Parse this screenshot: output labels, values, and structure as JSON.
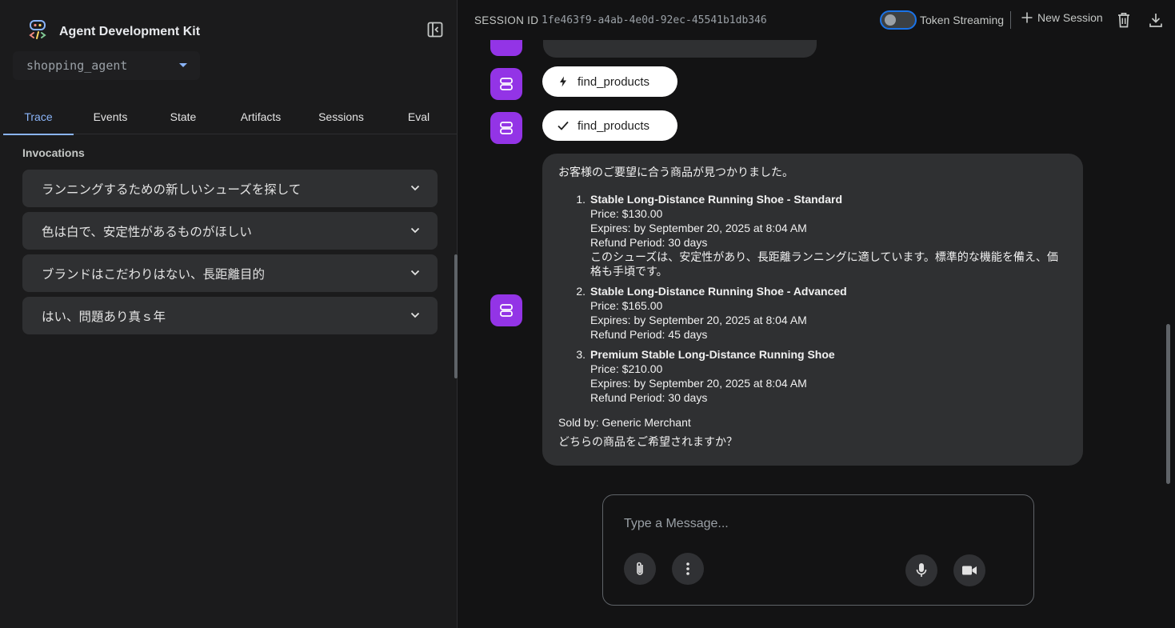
{
  "app": {
    "title": "Agent Development Kit",
    "agent_name": "shopping_agent"
  },
  "tabs": [
    {
      "label": "Trace",
      "active": true
    },
    {
      "label": "Events"
    },
    {
      "label": "State"
    },
    {
      "label": "Artifacts"
    },
    {
      "label": "Sessions"
    },
    {
      "label": "Eval"
    }
  ],
  "invocations": {
    "heading": "Invocations",
    "items": [
      "ランニングするための新しいシューズを探して",
      "色は白で、安定性があるものがほしい",
      "ブランドはこだわりはない、長距離目的",
      "はい、問題あり真ｓ年"
    ]
  },
  "topbar": {
    "session_label": "SESSION ID",
    "session_id": "1fe463f9-a4ab-4e0d-92ec-45541b1db346",
    "token_streaming_label": "Token Streaming",
    "new_session_label": "New Session"
  },
  "chat": {
    "function_call": "find_products",
    "function_response": "find_products",
    "message": {
      "intro": "お客様のご要望に合う商品が見つかりました。",
      "items": [
        {
          "num": "1.",
          "name": "Stable Long-Distance Running Shoe - Standard",
          "price": "Price: $130.00",
          "expires": "Expires: by September 20, 2025 at 8:04 AM",
          "refund": "Refund Period: 30 days",
          "desc": "このシューズは、安定性があり、長距離ランニングに適しています。標準的な機能を備え、価格も手頃です。"
        },
        {
          "num": "2.",
          "name": "Stable Long-Distance Running Shoe - Advanced",
          "price": "Price: $165.00",
          "expires": "Expires: by September 20, 2025 at 8:04 AM",
          "refund": "Refund Period: 45 days"
        },
        {
          "num": "3.",
          "name": "Premium Stable Long-Distance Running Shoe",
          "price": "Price: $210.00",
          "expires": "Expires: by September 20, 2025 at 8:04 AM",
          "refund": "Refund Period: 30 days"
        }
      ],
      "sold_by": "Sold by: Generic Merchant",
      "question": "どちらの商品をご希望されますか？"
    }
  },
  "composer": {
    "placeholder": "Type a Message..."
  },
  "colors": {
    "accent": "#8ab4f8",
    "avatar": "#9334e6",
    "bubble": "#2f3032",
    "background": "#131314",
    "sidebar": "#1b1b1c"
  }
}
